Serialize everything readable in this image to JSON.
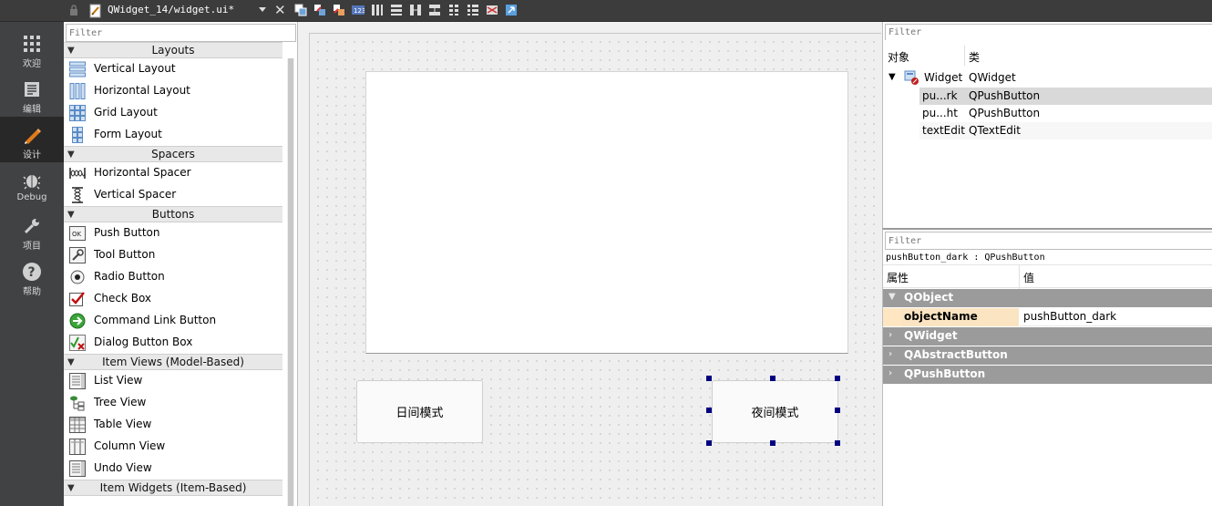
{
  "toolbar": {
    "file_title": "QWidget_14/widget.ui*",
    "tools": [
      "edit-widgets-icon",
      "edit-signals-icon",
      "edit-buddies-icon",
      "edit-tab-order-icon",
      "layout-horizontal-icon",
      "layout-vertical-icon",
      "layout-h-splitter-icon",
      "layout-v-splitter-icon",
      "layout-grid-icon",
      "layout-form-icon",
      "break-layout-icon",
      "adjust-size-icon"
    ]
  },
  "modes": [
    {
      "label": "欢迎",
      "icon": "welcome-grid-icon"
    },
    {
      "label": "编辑",
      "icon": "edit-doc-icon"
    },
    {
      "label": "设计",
      "icon": "design-pencil-icon"
    },
    {
      "label": "Debug",
      "icon": "debug-bug-icon"
    },
    {
      "label": "项目",
      "icon": "project-wrench-icon"
    },
    {
      "label": "帮助",
      "icon": "help-icon"
    }
  ],
  "widget_box": {
    "filter_placeholder": "Filter",
    "categories": [
      {
        "title": "Layouts",
        "items": [
          "Vertical Layout",
          "Horizontal Layout",
          "Grid Layout",
          "Form Layout"
        ]
      },
      {
        "title": "Spacers",
        "items": [
          "Horizontal Spacer",
          "Vertical Spacer"
        ]
      },
      {
        "title": "Buttons",
        "items": [
          "Push Button",
          "Tool Button",
          "Radio Button",
          "Check Box",
          "Command Link Button",
          "Dialog Button Box"
        ]
      },
      {
        "title": "Item Views (Model-Based)",
        "items": [
          "List View",
          "Tree View",
          "Table View",
          "Column View",
          "Undo View"
        ]
      },
      {
        "title": "Item Widgets (Item-Based)",
        "items": []
      }
    ]
  },
  "form": {
    "day_button": "日间模式",
    "night_button": "夜间模式"
  },
  "object_inspector": {
    "filter_placeholder": "Filter",
    "col_object": "对象",
    "col_class": "类",
    "rows": [
      {
        "name": "Widget",
        "class": "QWidget"
      },
      {
        "name": "pu...rk",
        "class": "QPushButton"
      },
      {
        "name": "pu...ht",
        "class": "QPushButton"
      },
      {
        "name": "textEdit",
        "class": "QTextEdit"
      }
    ]
  },
  "property_editor": {
    "filter_placeholder": "Filter",
    "object_label": "pushButton_dark : QPushButton",
    "col_property": "属性",
    "col_value": "值",
    "groups": [
      "QObject",
      "QWidget",
      "QAbstractButton",
      "QPushButton"
    ],
    "object_name_key": "objectName",
    "object_name_value": "pushButton_dark"
  }
}
